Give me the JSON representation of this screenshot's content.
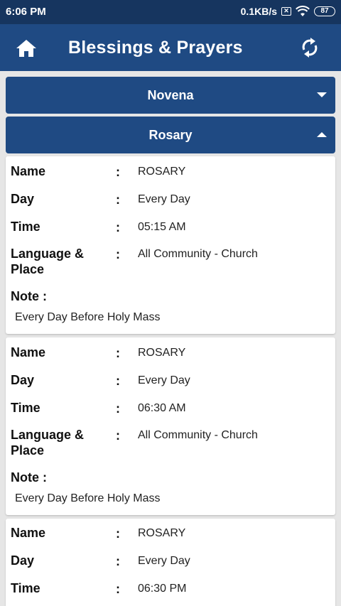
{
  "status": {
    "time": "6:06 PM",
    "speed": "0.1KB/s",
    "battery": "87"
  },
  "app_bar": {
    "title": "Blessings & Prayers",
    "home_icon": "home-icon",
    "refresh_icon": "refresh-icon"
  },
  "sections": [
    {
      "label": "Novena",
      "expanded": false
    },
    {
      "label": "Rosary",
      "expanded": true
    }
  ],
  "labels": {
    "name": "Name",
    "day": "Day",
    "time": "Time",
    "language_place": "Language &\nPlace",
    "note": "Note  :",
    "colon": ":"
  },
  "entries": [
    {
      "name": "ROSARY",
      "day": "Every Day",
      "time": "05:15 AM",
      "language_place": "All Community - Church",
      "note": "Every Day Before Holy Mass"
    },
    {
      "name": "ROSARY",
      "day": "Every Day",
      "time": "06:30 AM",
      "language_place": "All Community - Church",
      "note": "Every Day Before Holy Mass"
    },
    {
      "name": "ROSARY",
      "day": "Every Day",
      "time": "06:30 PM"
    }
  ]
}
